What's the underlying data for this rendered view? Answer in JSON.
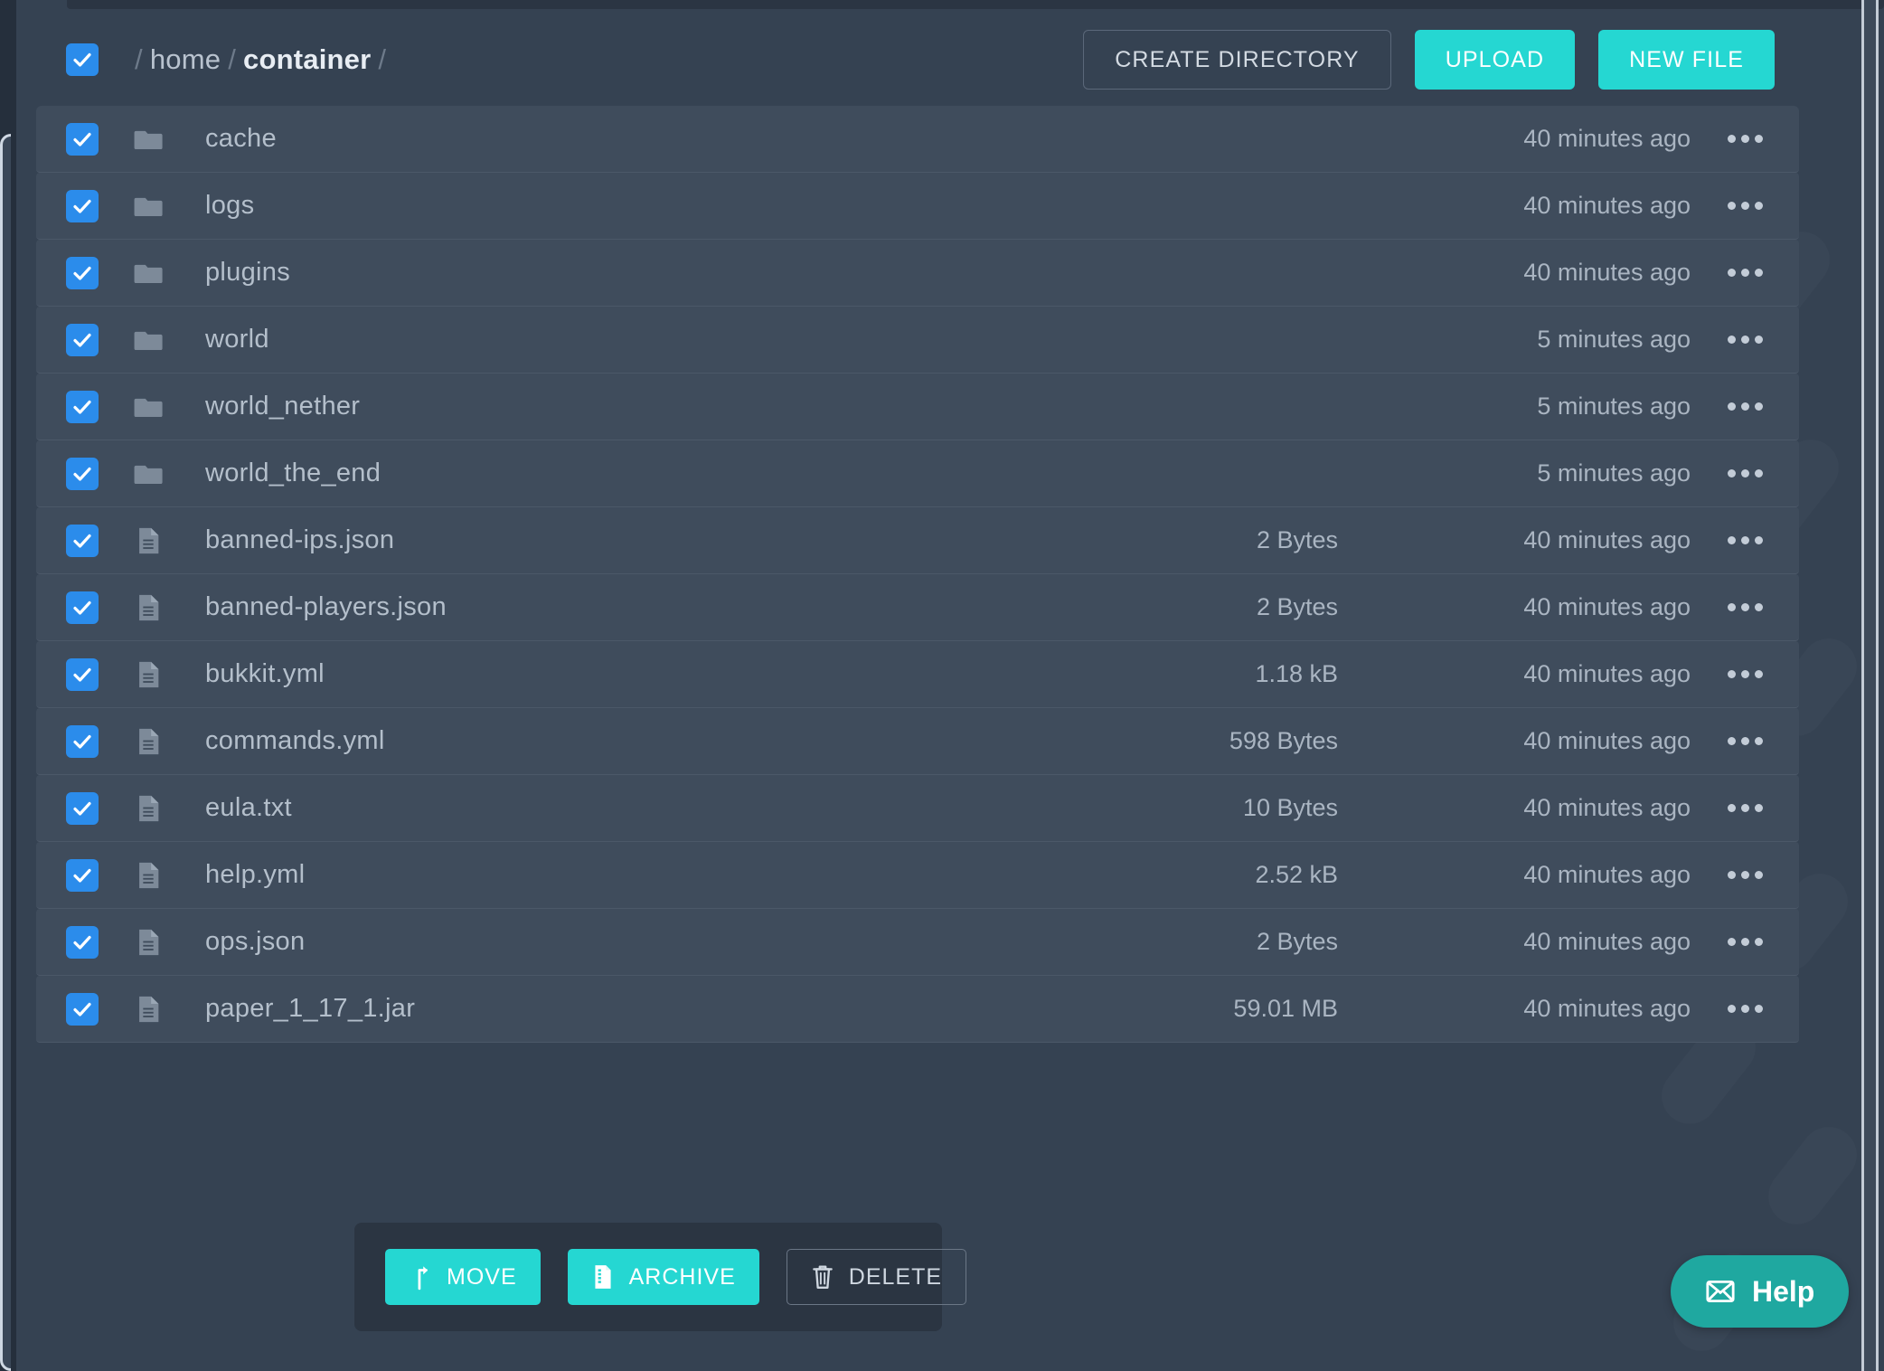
{
  "breadcrumb": {
    "root_sep": "/",
    "crumbs": [
      "home",
      "container"
    ],
    "trailing_sep": "/"
  },
  "header": {
    "create_directory_label": "CREATE DIRECTORY",
    "upload_label": "UPLOAD",
    "new_file_label": "NEW FILE"
  },
  "colors": {
    "accent_teal": "#25d7d2",
    "checkbox_blue": "#2b8ceb",
    "help_teal": "#1fa8a0",
    "row_bg": "#3f4c5c",
    "page_bg": "#354252"
  },
  "files": [
    {
      "name": "cache",
      "type": "folder",
      "size": "",
      "modified": "40 minutes ago",
      "selected": true
    },
    {
      "name": "logs",
      "type": "folder",
      "size": "",
      "modified": "40 minutes ago",
      "selected": true
    },
    {
      "name": "plugins",
      "type": "folder",
      "size": "",
      "modified": "40 minutes ago",
      "selected": true
    },
    {
      "name": "world",
      "type": "folder",
      "size": "",
      "modified": "5 minutes ago",
      "selected": true
    },
    {
      "name": "world_nether",
      "type": "folder",
      "size": "",
      "modified": "5 minutes ago",
      "selected": true
    },
    {
      "name": "world_the_end",
      "type": "folder",
      "size": "",
      "modified": "5 minutes ago",
      "selected": true
    },
    {
      "name": "banned-ips.json",
      "type": "file",
      "size": "2 Bytes",
      "modified": "40 minutes ago",
      "selected": true
    },
    {
      "name": "banned-players.json",
      "type": "file",
      "size": "2 Bytes",
      "modified": "40 minutes ago",
      "selected": true
    },
    {
      "name": "bukkit.yml",
      "type": "file",
      "size": "1.18 kB",
      "modified": "40 minutes ago",
      "selected": true
    },
    {
      "name": "commands.yml",
      "type": "file",
      "size": "598 Bytes",
      "modified": "40 minutes ago",
      "selected": true
    },
    {
      "name": "eula.txt",
      "type": "file",
      "size": "10 Bytes",
      "modified": "40 minutes ago",
      "selected": true
    },
    {
      "name": "help.yml",
      "type": "file",
      "size": "2.52 kB",
      "modified": "40 minutes ago",
      "selected": true
    },
    {
      "name": "ops.json",
      "type": "file",
      "size": "2 Bytes",
      "modified": "40 minutes ago",
      "selected": true
    },
    {
      "name": "paper_1_17_1.jar",
      "type": "file",
      "size": "59.01 MB",
      "modified": "40 minutes ago",
      "selected": true
    }
  ],
  "action_bar": {
    "move_label": "MOVE",
    "archive_label": "ARCHIVE",
    "delete_label": "DELETE"
  },
  "help": {
    "label": "Help"
  }
}
